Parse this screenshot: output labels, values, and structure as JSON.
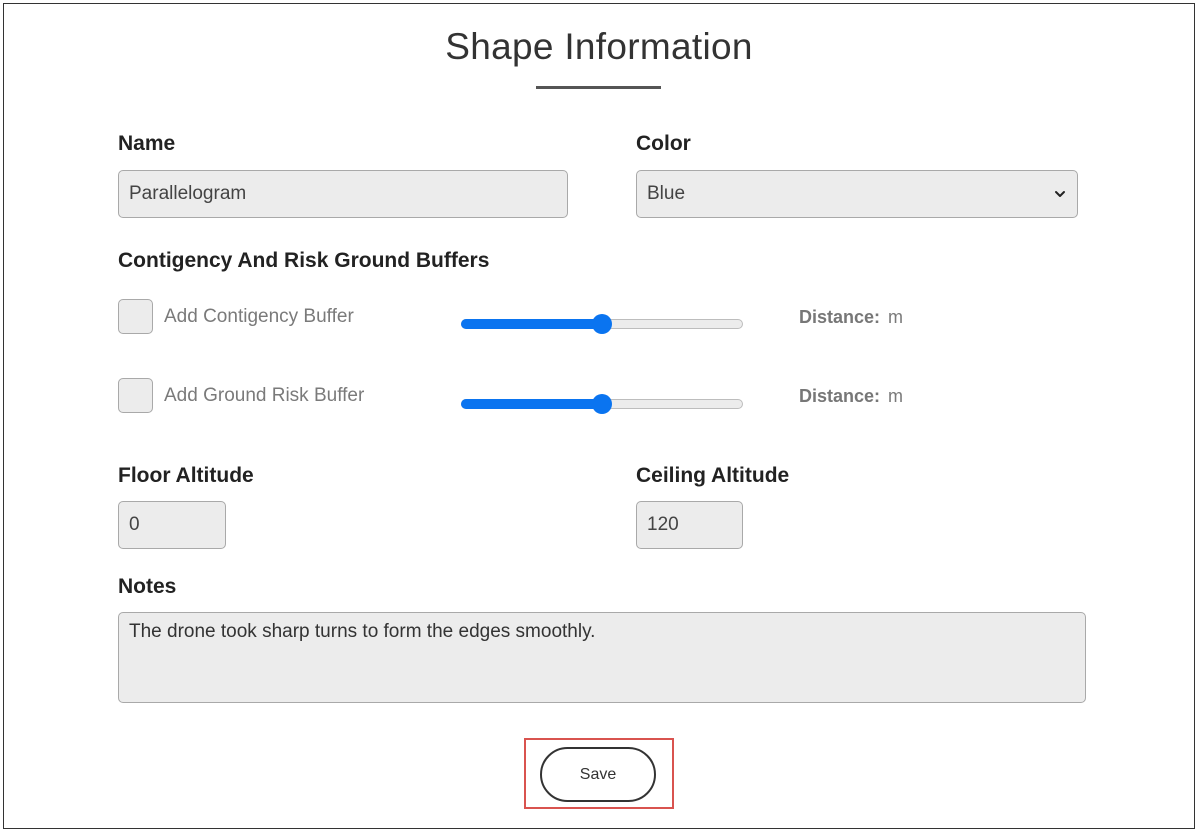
{
  "page": {
    "title": "Shape Information"
  },
  "name": {
    "label": "Name",
    "value": "Parallelogram"
  },
  "color": {
    "label": "Color",
    "selected": "Blue",
    "chevron_icon": "chevron-down-icon"
  },
  "buffers": {
    "section_label": "Contigency And Risk Ground Buffers",
    "items": [
      {
        "checkbox_label": "Add Contigency Buffer",
        "checked": false,
        "slider_level_percent": 50,
        "distance_label": "Distance:",
        "distance_unit": "m"
      },
      {
        "checkbox_label": "Add Ground Risk Buffer",
        "checked": false,
        "slider_level_percent": 50,
        "distance_label": "Distance:",
        "distance_unit": "m"
      }
    ]
  },
  "floor_altitude": {
    "label": "Floor Altitude",
    "value": "0"
  },
  "ceiling_altitude": {
    "label": "Ceiling Altitude",
    "value": "120"
  },
  "notes": {
    "label": "Notes",
    "value": "The drone took sharp turns to form the edges smoothly."
  },
  "actions": {
    "save_label": "Save"
  },
  "colors": {
    "slider_accent": "#0a74f0",
    "field_background": "#ececec",
    "highlight_border": "#d9534f"
  }
}
